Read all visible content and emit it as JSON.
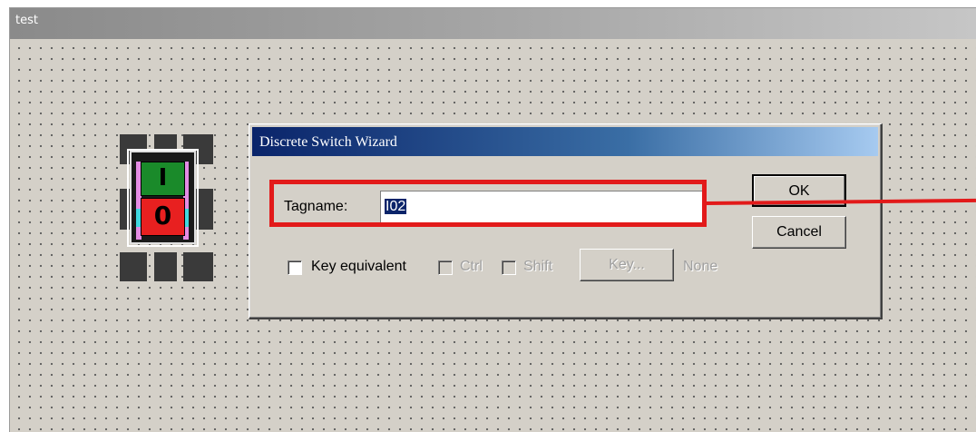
{
  "canvas": {
    "title": "test"
  },
  "switch": {
    "on_label": "I",
    "off_label": "0"
  },
  "dialog": {
    "title": "Discrete Switch Wizard",
    "tagname_label": "Tagname:",
    "tagname_value": "I02",
    "ok_label": "OK",
    "cancel_label": "Cancel",
    "key_equivalent_label": "Key equivalent",
    "key_equivalent_checked": false,
    "ctrl_label": "Ctrl",
    "shift_label": "Shift",
    "key_button_label": "Key...",
    "key_value": "None"
  },
  "colors": {
    "highlight": "#e21a1a",
    "titlebar": "#0a246a",
    "switch_on": "#1a8a2a",
    "switch_off": "#e82020"
  }
}
